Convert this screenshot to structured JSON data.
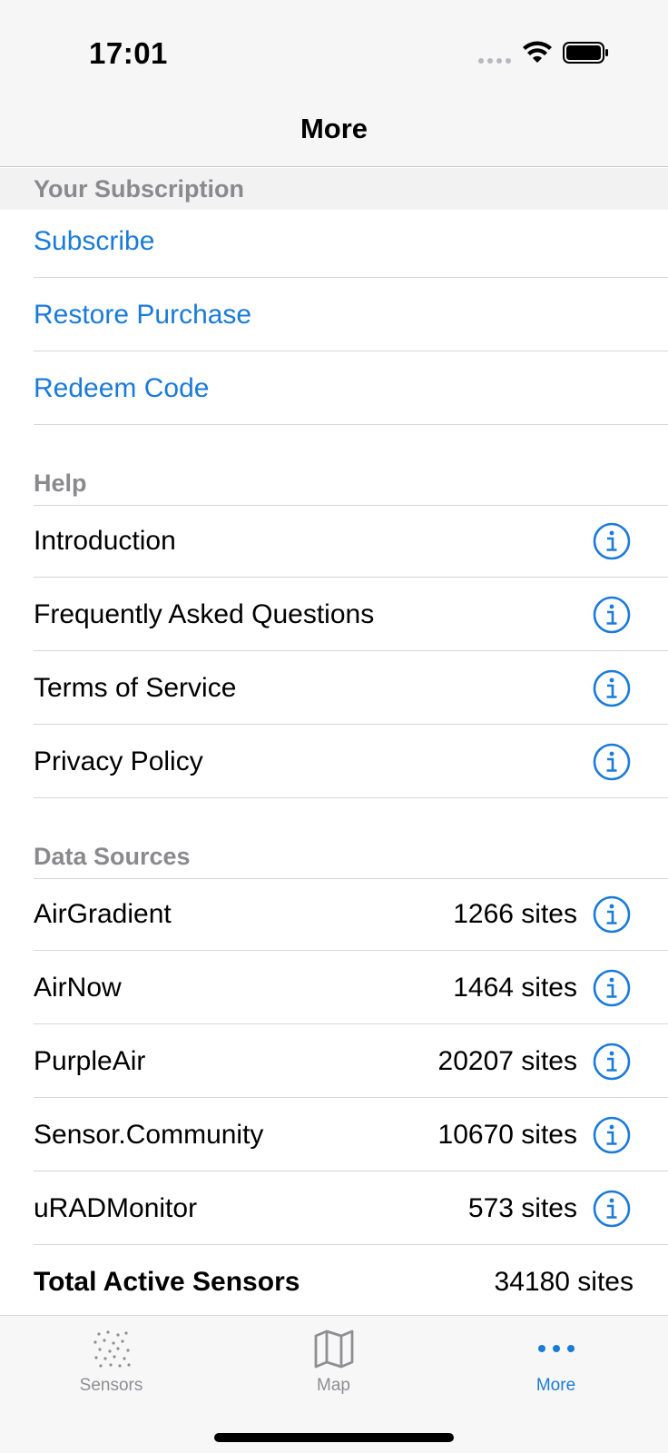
{
  "status_bar": {
    "time": "17:01"
  },
  "nav": {
    "title": "More"
  },
  "subscription": {
    "header": "Your Subscription",
    "items": [
      {
        "label": "Subscribe"
      },
      {
        "label": "Restore Purchase"
      },
      {
        "label": "Redeem Code"
      }
    ]
  },
  "help": {
    "header": "Help",
    "items": [
      {
        "label": "Introduction",
        "icon": "info-icon"
      },
      {
        "label": "Frequently Asked Questions",
        "icon": "info-icon"
      },
      {
        "label": "Terms of Service",
        "icon": "info-icon"
      },
      {
        "label": "Privacy Policy",
        "icon": "info-icon"
      }
    ]
  },
  "data_sources": {
    "header": "Data Sources",
    "items": [
      {
        "label": "AirGradient",
        "value": "1266 sites",
        "icon": "info-icon"
      },
      {
        "label": "AirNow",
        "value": "1464 sites",
        "icon": "info-icon"
      },
      {
        "label": "PurpleAir",
        "value": "20207 sites",
        "icon": "info-icon"
      },
      {
        "label": "Sensor.Community",
        "value": "10670 sites",
        "icon": "info-icon"
      },
      {
        "label": "uRADMonitor",
        "value": "573 sites",
        "icon": "info-icon"
      }
    ],
    "total": {
      "label": "Total Active Sensors",
      "value": "34180 sites"
    }
  },
  "tabs": [
    {
      "label": "Sensors",
      "icon": "sensors-icon",
      "active": false
    },
    {
      "label": "Map",
      "icon": "map-icon",
      "active": false
    },
    {
      "label": "More",
      "icon": "more-icon",
      "active": true
    }
  ],
  "colors": {
    "accent": "#1a7bd8",
    "secondary_text": "#8a8a8e",
    "separator": "#d6d6d8"
  }
}
